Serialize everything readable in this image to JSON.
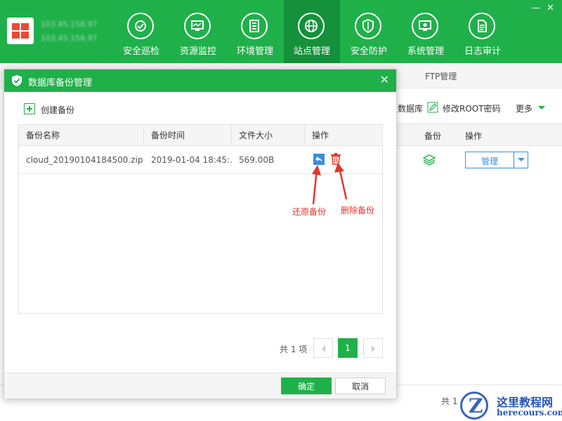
{
  "topnav": {
    "host_line1": "103.45.158.97",
    "host_line2": "103.45.158.97",
    "items": [
      {
        "label": "安全巡检",
        "icon": "inspect-icon"
      },
      {
        "label": "资源监控",
        "icon": "monitor-icon"
      },
      {
        "label": "环境管理",
        "icon": "server-icon"
      },
      {
        "label": "站点管理",
        "icon": "globe-icon"
      },
      {
        "label": "安全防护",
        "icon": "shield-icon"
      },
      {
        "label": "系统管理",
        "icon": "system-icon"
      },
      {
        "label": "日志审计",
        "icon": "log-icon"
      }
    ],
    "active_index": 3,
    "minimize": "—",
    "close": "✕"
  },
  "background": {
    "ftp_tab": "FTP管理",
    "toolbar_partial": "数据库",
    "modify_root": "修改ROOT密码",
    "more": "更多",
    "col_backup": "备份",
    "col_action": "操作",
    "manage_btn": "管理",
    "footer_partial": "共 1"
  },
  "modal": {
    "title": "数据库备份管理",
    "create_label": "创建备份",
    "columns": [
      "备份名称",
      "备份时间",
      "文件大小",
      "操作"
    ],
    "rows": [
      {
        "name": "cloud_20190104184500.zip",
        "time": "2019-01-04 18:45:...",
        "size": "569.00B"
      }
    ],
    "annotation_restore": "还原备份",
    "annotation_delete": "删除备份",
    "pager": {
      "total": "共 1 项",
      "current": "1"
    },
    "ok": "确定",
    "cancel": "取消"
  },
  "watermark": {
    "logo_letter": "Z",
    "cn": "这里教程网",
    "en": "herecours.com"
  },
  "colors": {
    "brand_green": "#20b04a",
    "active_green": "#14913a",
    "link_blue": "#3c8dde",
    "annotation_red": "#e0362c"
  }
}
